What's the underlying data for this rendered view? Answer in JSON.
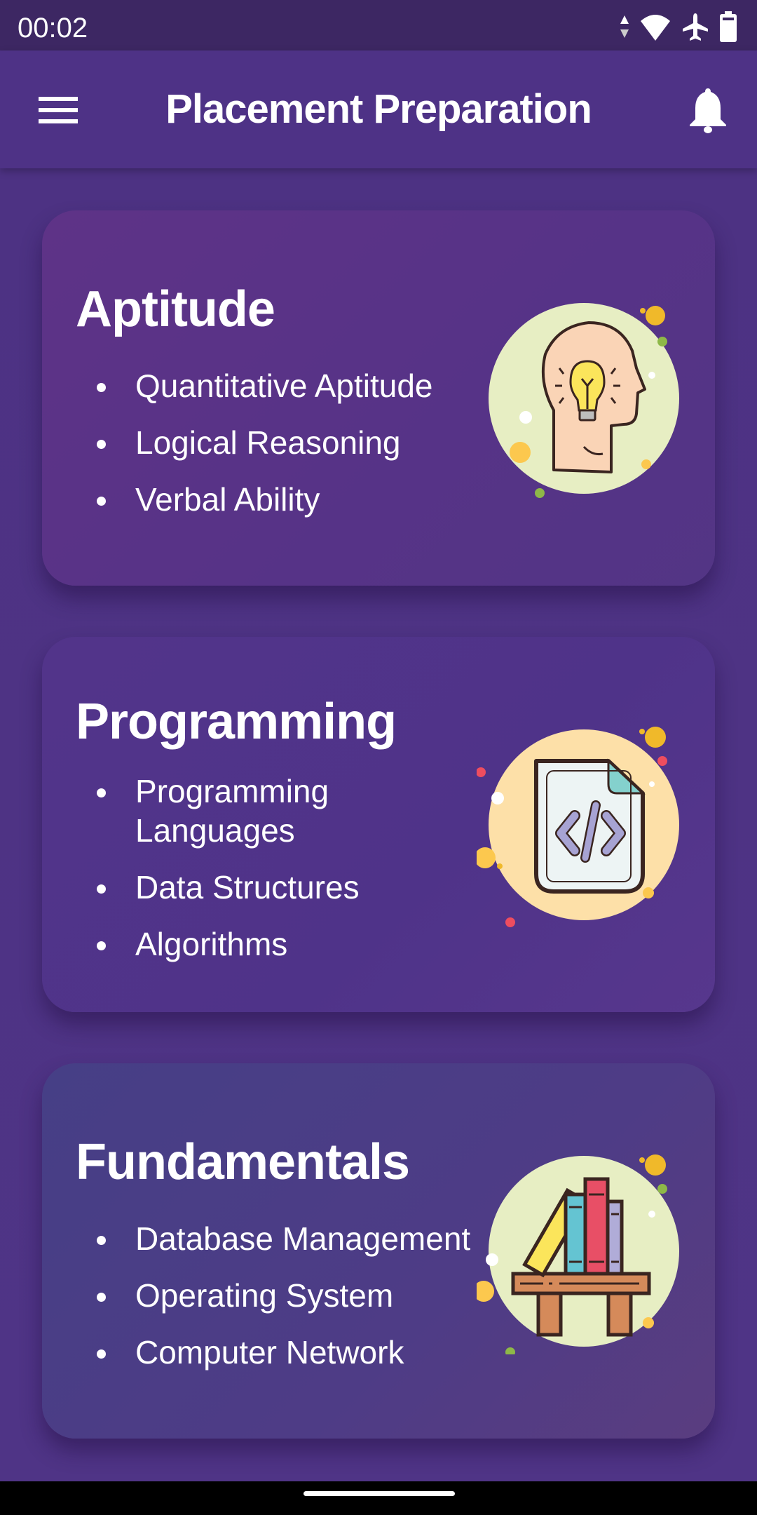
{
  "status_bar": {
    "time": "00:02",
    "icons": [
      "data-arrows-icon",
      "wifi-icon",
      "airplane-mode-icon",
      "battery-icon"
    ]
  },
  "app_bar": {
    "title": "Placement Preparation",
    "menu_icon": "hamburger-menu-icon",
    "notification_icon": "bell-icon"
  },
  "cards": [
    {
      "title": "Aptitude",
      "items": [
        "Quantitative Aptitude",
        "Logical Reasoning",
        "Verbal Ability"
      ],
      "illustration": "head-lightbulb-icon"
    },
    {
      "title": "Programming",
      "items": [
        "Programming Languages",
        "Data Structures",
        "Algorithms"
      ],
      "illustration": "code-file-icon"
    },
    {
      "title": "Fundamentals",
      "items": [
        "Database Management",
        "Operating System",
        "Computer Network"
      ],
      "illustration": "bookshelf-icon"
    }
  ],
  "colors": {
    "status_bar": "#3d2763",
    "app_bar": "#4e3286",
    "background": "#4e3386",
    "text": "#ffffff"
  }
}
